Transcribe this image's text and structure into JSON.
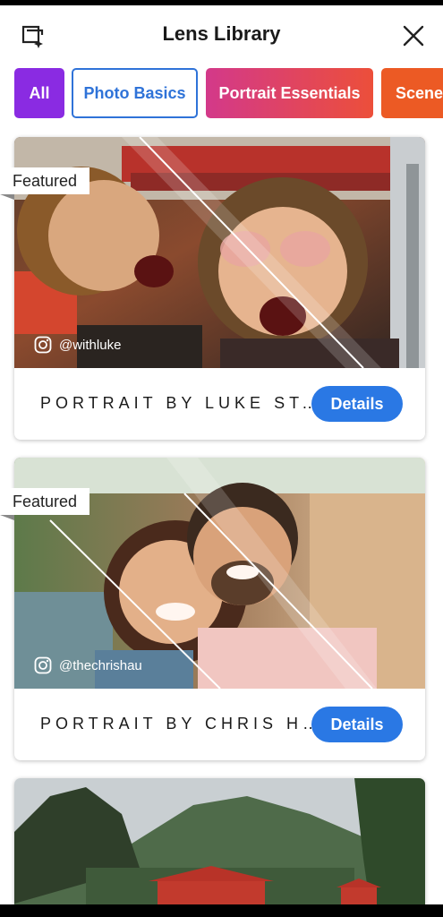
{
  "header": {
    "title": "Lens Library",
    "left_icon": "add-lens-icon",
    "close_icon": "close-icon"
  },
  "filters": {
    "items": [
      {
        "label": "All"
      },
      {
        "label": "Photo Basics"
      },
      {
        "label": "Portrait Essentials"
      },
      {
        "label": "Scener"
      }
    ],
    "selected": "Photo Basics"
  },
  "cards": [
    {
      "badge": "Featured",
      "handle": "@withluke",
      "title": "PORTRAIT BY LUKE ST...",
      "button": "Details"
    },
    {
      "badge": "Featured",
      "handle": "@thechrishau",
      "title": "PORTRAIT BY CHRIS H...",
      "button": "Details"
    }
  ],
  "colors": {
    "accent_blue": "#2a78e4",
    "chip_all": "#8a2be2",
    "chip_portrait_start": "#d3398a",
    "chip_portrait_end": "#ec4f3a",
    "chip_scenery": "#ec5a24"
  }
}
